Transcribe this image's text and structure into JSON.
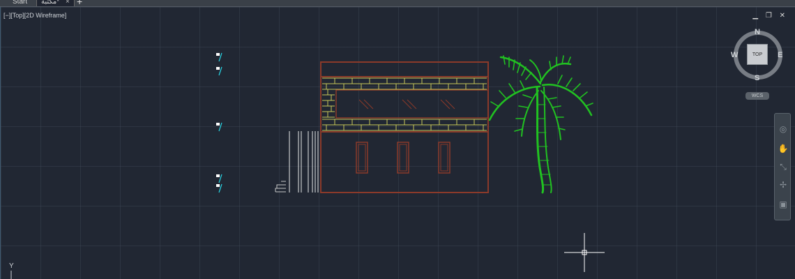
{
  "tabs": {
    "start_label": "Start",
    "drawing_label": "مكتبة*",
    "close_glyph": "×",
    "new_tab_glyph": "+"
  },
  "viewport": {
    "view_label": "[−][Top][2D Wireframe]",
    "window_controls": "▁ ❐ ✕"
  },
  "viewcube": {
    "top_face": "TOP",
    "north": "N",
    "south": "S",
    "east": "E",
    "west": "W",
    "wcs_label": "WCS"
  },
  "navbar": {
    "tools": [
      "steering-wheel-icon",
      "pan-hand-icon",
      "zoom-extents-icon",
      "orbit-icon",
      "showmotion-icon"
    ]
  },
  "ucs": {
    "y_label": "Y"
  },
  "colors": {
    "background": "#212733",
    "wall_outline": "#8b3a2a",
    "brick": "#c9c95a",
    "tree": "#21c221",
    "annotation": "#27d7e6",
    "stairs": "#ffffff"
  }
}
